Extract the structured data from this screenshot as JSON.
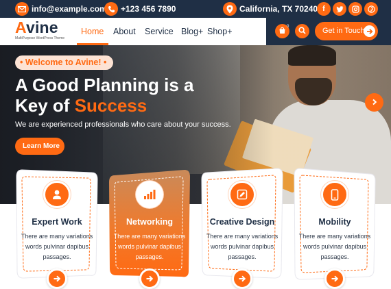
{
  "topbar": {
    "email": "info@example.com",
    "phone": "+123 456 7890",
    "location": "California, TX 70240",
    "social": [
      "facebook-icon",
      "twitter-icon",
      "instagram-icon",
      "pinterest-icon"
    ]
  },
  "brand": {
    "logo_first": "A",
    "logo_rest": "vine",
    "tagline": "MultiPurpose WordPress Theme"
  },
  "nav": {
    "items": [
      {
        "label": "Home",
        "active": true
      },
      {
        "label": "About"
      },
      {
        "label": "Service"
      },
      {
        "label": "Blog+"
      },
      {
        "label": "Shop+"
      }
    ]
  },
  "header_actions": {
    "cart_count": "0",
    "cta_label": "Get in Touch"
  },
  "hero": {
    "badge": "• Welcome to Avine! •",
    "title_line1": "A Good Planning is a",
    "title_line2_prefix": "Key of ",
    "title_line2_highlight": "Success",
    "subtitle": "We are experienced professionals who care about your success.",
    "button": "Learn More"
  },
  "cards": [
    {
      "title": "Expert Work",
      "icon": "user-icon",
      "desc": "There are many variations words pulvinar dapibus passages."
    },
    {
      "title": "Networking",
      "icon": "bar-chart-icon",
      "desc": "There are many variations words pulvinar dapibus passages.",
      "featured": true
    },
    {
      "title": "Creative Design",
      "icon": "pencil-icon",
      "desc": "There are many variations words pulvinar dapibus passages."
    },
    {
      "title": "Mobility",
      "icon": "mobile-icon",
      "desc": "There are many variations words pulvinar dapibus passages."
    }
  ],
  "colors": {
    "accent": "#ff6a13",
    "dark": "#1f2f45",
    "badge_bg": "#fde3d4"
  }
}
